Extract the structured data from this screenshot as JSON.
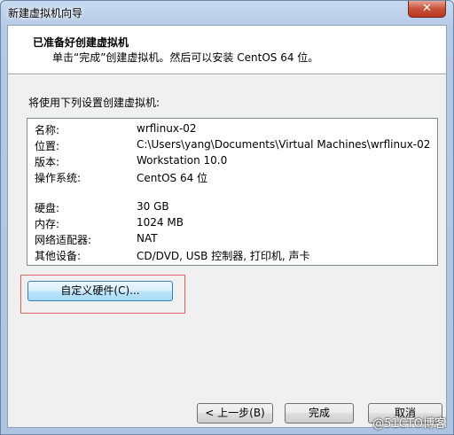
{
  "window": {
    "title": "新建虚拟机向导"
  },
  "header": {
    "title": "已准备好创建虚拟机",
    "subtitle": "单击“完成”创建虚拟机。然后可以安装 CentOS 64 位。"
  },
  "intro": "将使用下列设置创建虚拟机:",
  "summary": [
    {
      "key": "名称:",
      "value": "wrflinux-02"
    },
    {
      "key": "位置:",
      "value": "C:\\Users\\yang\\Documents\\Virtual Machines\\wrflinux-02"
    },
    {
      "key": "版本:",
      "value": "Workstation 10.0"
    },
    {
      "key": "操作系统:",
      "value": "CentOS 64 位"
    },
    {
      "key": "硬盘:",
      "value": "30 GB"
    },
    {
      "key": "内存:",
      "value": "1024 MB"
    },
    {
      "key": "网络适配器:",
      "value": "NAT"
    },
    {
      "key": "其他设备:",
      "value": "CD/DVD, USB 控制器, 打印机, 声卡"
    }
  ],
  "buttons": {
    "customize": "自定义硬件(C)...",
    "back": "< 上一步(B)",
    "finish": "完成",
    "cancel": "取消"
  },
  "watermark": "@51CTO博客",
  "colors": {
    "highlight": "#e06060",
    "titlebar": "#c8daf0"
  }
}
